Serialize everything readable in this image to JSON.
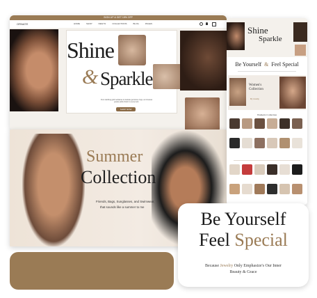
{
  "topbar": {
    "announcement": "SIGN UP & GET 15% OFF",
    "logo": "ORNATE",
    "nav": [
      "HOME",
      "SHOP",
      "NEW IN",
      "COLLECTIONS",
      "BLOG",
      "PAGES"
    ]
  },
  "hero": {
    "title_line1": "Shine",
    "title_line2": "Sparkle",
    "ampersand": "&",
    "body": "From dazzling gold necklaces to delicate gemstone rings, our timeless jewelry adds charm to every look.",
    "button": "SHOP NOW"
  },
  "summer": {
    "title_line1": "Summer",
    "title_line2": "Collection",
    "body_line1": "Friends, Bags, Sunglasses, and Swimwear,",
    "body_line2": "that sounds like a summer to me"
  },
  "right_panel": {
    "hero_title_line1": "Shine",
    "hero_title_line2": "Sparkle",
    "tagline_part1": "Be Yourself",
    "tagline_part2": "Feel Special",
    "women_title": "Women's Collection",
    "women_sub": "By Jeremy",
    "grid_title": "Women's Collection"
  },
  "promo": {
    "line1": "Be Yourself",
    "line2_a": "Feel",
    "line2_b": "Special",
    "sub_a": "Because",
    "sub_highlight": "Jewelry",
    "sub_b": "Only Emphasize's Our Inner",
    "sub_c": "Beauty & Grace"
  },
  "colors": {
    "accent": "#9a7b55",
    "cream": "#efe8df",
    "dark": "#1a1a1a"
  }
}
